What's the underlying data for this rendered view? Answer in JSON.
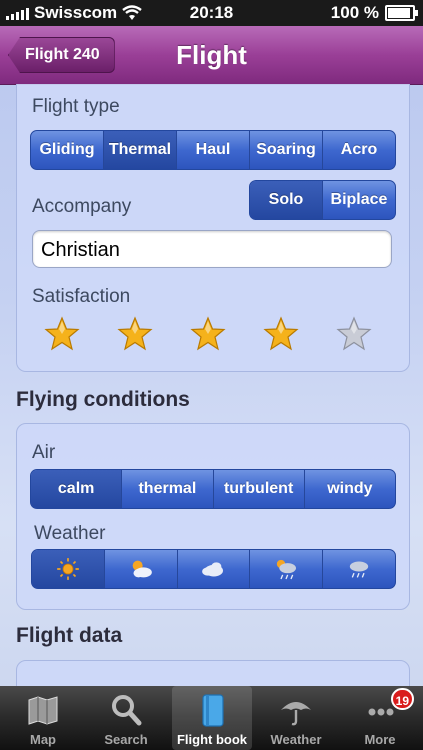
{
  "status": {
    "carrier": "Swisscom",
    "time": "20:18",
    "battery": "100 %",
    "battery_level": 1.0
  },
  "nav": {
    "back_label": "Flight 240",
    "title": "Flight"
  },
  "flight_type": {
    "label": "Flight type",
    "options": [
      "Gliding",
      "Thermal",
      "Haul",
      "Soaring",
      "Acro"
    ],
    "selected": "Thermal"
  },
  "accompany": {
    "label": "Accompany",
    "options": [
      "Solo",
      "Biplace"
    ],
    "selected": "Solo",
    "value": "Christian"
  },
  "satisfaction": {
    "label": "Satisfaction",
    "max": 5,
    "rating": 4
  },
  "conditions": {
    "title": "Flying conditions",
    "air_label": "Air",
    "air_options": [
      "calm",
      "thermal",
      "turbulent",
      "windy"
    ],
    "air_selected": "calm",
    "weather_label": "Weather",
    "weather_icons": [
      "sun-icon",
      "sun-cloud-icon",
      "cloud-icon",
      "rain-sun-icon",
      "rain-icon"
    ],
    "weather_selected": 0
  },
  "flight_data": {
    "title": "Flight data"
  },
  "tabs": [
    {
      "label": "Map",
      "icon": "map-icon"
    },
    {
      "label": "Search",
      "icon": "search-icon"
    },
    {
      "label": "Flight book",
      "icon": "book-icon",
      "selected": true
    },
    {
      "label": "Weather",
      "icon": "umbrella-icon"
    },
    {
      "label": "More",
      "icon": "more-icon",
      "badge": "19"
    }
  ],
  "colors": {
    "nav": "#9a3f97",
    "segment": "#3e68cf",
    "star": "#f5b21b"
  }
}
